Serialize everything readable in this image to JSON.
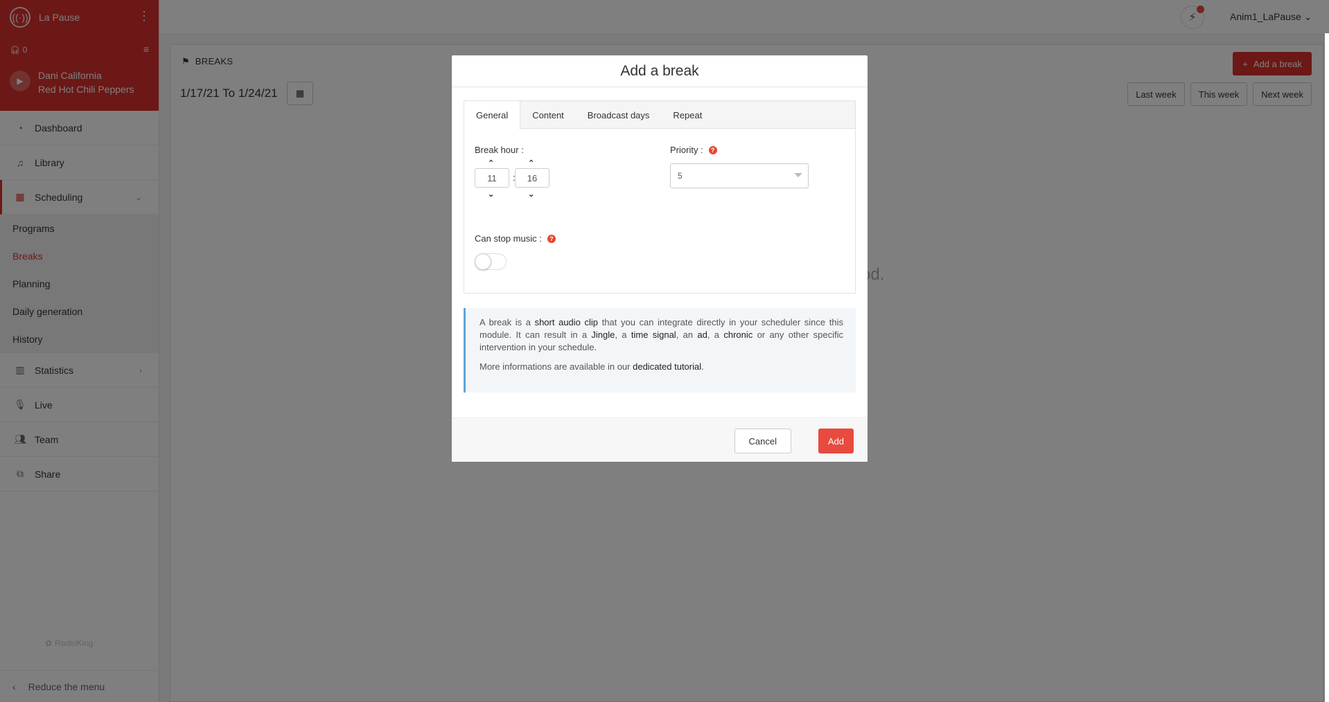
{
  "sidebar": {
    "brand": "La Pause",
    "listeners": "0",
    "now_playing": {
      "title": "Dani California",
      "artist": "Red Hot Chili Peppers"
    },
    "nav": {
      "dashboard": "Dashboard",
      "library": "Library",
      "scheduling": "Scheduling",
      "statistics": "Statistics",
      "live": "Live",
      "team": "Team",
      "share": "Share"
    },
    "sub": [
      "Programs",
      "Breaks",
      "Planning",
      "Daily generation",
      "History"
    ],
    "watermark": "RadioKing",
    "reduce": "Reduce the menu"
  },
  "topbar": {
    "user": "Anim1_LaPause"
  },
  "page": {
    "title": "BREAKS",
    "date_range": "1/17/21 To 1/24/21",
    "add_break": "Add a break",
    "weeks": [
      "Last week",
      "This week",
      "Next week"
    ],
    "empty_fragment": "od."
  },
  "modal": {
    "title": "Add a break",
    "tabs": [
      "General",
      "Content",
      "Broadcast days",
      "Repeat"
    ],
    "break_hour_label": "Break hour :",
    "hour": "11",
    "minute": "16",
    "separator": ":",
    "priority_label": "Priority :",
    "priority_value": "5",
    "can_stop_label": "Can stop music :",
    "info": {
      "p1_a": "A break is a ",
      "p1_b": "short audio clip",
      "p1_c": " that you can integrate directly in your scheduler since this module. It can result in a ",
      "p1_d": "Jingle",
      "p1_e": ", a ",
      "p1_f": "time signal",
      "p1_g": ", an ",
      "p1_h": "ad",
      "p1_i": ", a ",
      "p1_j": "chronic",
      "p1_k": " or any other specific intervention in your schedule.",
      "p2_a": "More informations are available in our ",
      "p2_b": "dedicated tutorial",
      "p2_c": "."
    },
    "cancel": "Cancel",
    "add": "Add"
  },
  "colors": {
    "accent": "#d9302c",
    "info_border": "#5aa7d6",
    "add_button": "#e84a3f"
  },
  "icons": [
    "radio-icon",
    "headphones-icon",
    "queue-icon",
    "play-icon",
    "dashboard-icon",
    "music-icon",
    "calendar-icon",
    "chevron-down-icon",
    "bar-chart-icon",
    "mic-icon",
    "users-icon",
    "share-icon",
    "chevron-left-icon",
    "flag-icon",
    "plus-icon",
    "bolt-icon",
    "help-icon"
  ]
}
